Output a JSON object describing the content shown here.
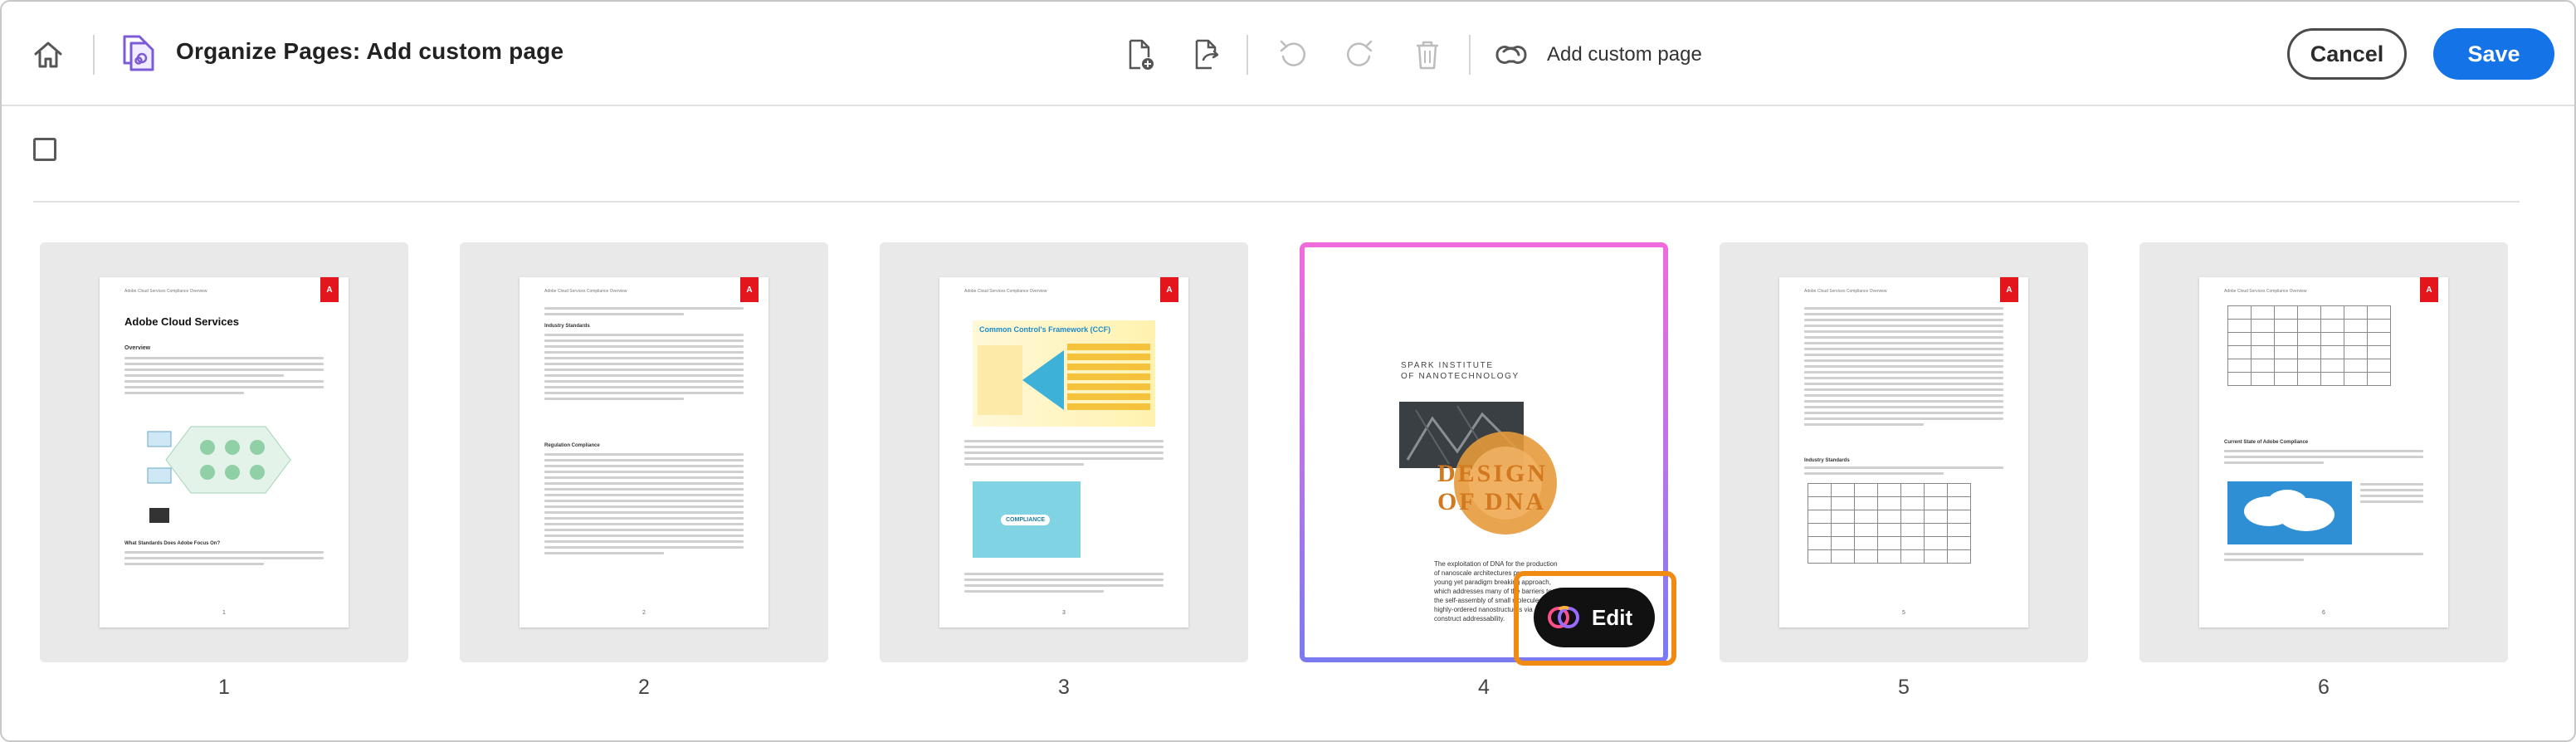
{
  "header": {
    "title": "Organize Pages: Add custom page",
    "add_custom_label": "Add custom page",
    "cancel_label": "Cancel",
    "save_label": "Save"
  },
  "icons": {
    "home": "home-icon",
    "app": "organize-pages-icon",
    "insert": "insert-page-icon",
    "replace": "replace-page-icon",
    "undo": "undo-icon",
    "redo": "redo-icon",
    "delete": "trash-icon",
    "link": "link-icon",
    "edit": "creative-cloud-icon"
  },
  "colors": {
    "accent": "#1473e6",
    "highlight": "#f08a12",
    "adobe_red": "#e3161d"
  },
  "pages": [
    {
      "number": "1",
      "title": "Adobe Cloud Services",
      "section": "Overview",
      "footer": "1"
    },
    {
      "number": "2",
      "section": "Industry Standards",
      "section2": "Regulation Compliance",
      "footer": "2"
    },
    {
      "number": "3",
      "banner": "Common Control's Framework (CCF)",
      "badge": "COMPLIANCE",
      "footer": "3"
    },
    {
      "number": "4",
      "org": "SPARK INSTITUTE\nOF NANOTECHNOLOGY",
      "cover_text": "DESIGN OF DNA",
      "blurb": "The exploitation of DNA for the production of nanoscale architectures presents a young yet paradigm breaking approach, which addresses many of the barriers to the self-assembly of small molecules into highly-ordered nanostructures via construct addressability."
    },
    {
      "number": "5",
      "section": "Industry Standards",
      "footer": "5"
    },
    {
      "number": "6",
      "section": "Current State of Adobe Compliance",
      "footer": "6"
    }
  ],
  "edit_button": {
    "label": "Edit"
  }
}
